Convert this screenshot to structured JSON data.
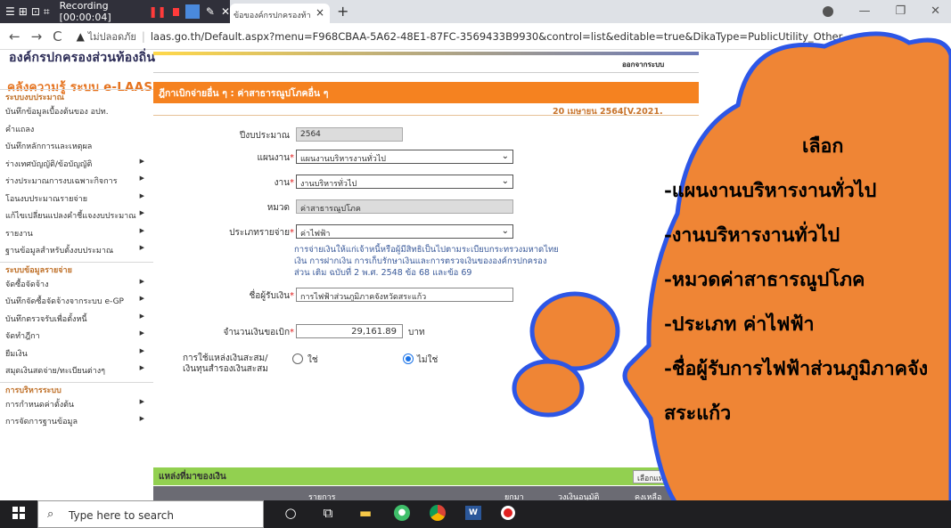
{
  "recorder": {
    "label": "Recording [00:00:04]"
  },
  "browser": {
    "tab_title": "ข้อของค์กรปกครองท้า",
    "not_secure": "ไม่ปลอดภัย",
    "url": "laas.go.th/Default.aspx?menu=F968CBAA-5A62-48E1-87FC-3569433B9930&control=list&editable=true&DikaType=PublicUtility_Other"
  },
  "header": {
    "org_name": "องค์กรปกครองส่วนท้องถิ่น",
    "logout": "ออกจากระบบ"
  },
  "sidebar": {
    "brand": "คลังความรู้ ระบบ e-LAAS",
    "sections": [
      {
        "title": "ระบบงบประมาณ",
        "items": [
          {
            "label": "บันทึกข้อมูลเบื้องต้นของ อปท.",
            "arrow": false
          },
          {
            "label": "คำแถลง",
            "arrow": false
          },
          {
            "label": "บันทึกหลักการและเหตุผล",
            "arrow": false
          },
          {
            "label": "ร่างเทศบัญญัติ/ข้อบัญญัติ",
            "arrow": true
          },
          {
            "label": "ร่างประมาณการงบเฉพาะกิจการ",
            "arrow": true
          },
          {
            "label": "โอนงบประมาณรายจ่าย",
            "arrow": true
          },
          {
            "label": "แก้ไขเปลี่ยนแปลงคำชี้แจงงบประมาณ",
            "arrow": true
          },
          {
            "label": "รายงาน",
            "arrow": true
          },
          {
            "label": "ฐานข้อมูลสำหรับตั้งงบประมาณ",
            "arrow": true
          }
        ]
      },
      {
        "title": "ระบบข้อมูลรายจ่าย",
        "items": [
          {
            "label": "จัดซื้อจัดจ้าง",
            "arrow": true
          },
          {
            "label": "บันทึกจัดซื้อจัดจ้างจากระบบ e-GP",
            "arrow": true
          },
          {
            "label": "บันทึกตรวจรับเพื่อตั้งหนี้",
            "arrow": true
          },
          {
            "label": "จัดทำฎีกา",
            "arrow": true
          },
          {
            "label": "ยืมเงิน",
            "arrow": true
          },
          {
            "label": "สมุดเงินสดจ่าย/ทะเบียนต่างๆ",
            "arrow": true
          }
        ]
      },
      {
        "title": "การบริหารระบบ",
        "items": [
          {
            "label": "การกำหนดค่าตั้งต้น",
            "arrow": true
          },
          {
            "label": "การจัดการฐานข้อมูล",
            "arrow": true
          }
        ]
      }
    ]
  },
  "page": {
    "title": "ฎีกาเบิกจ่ายอื่น ๆ : ค่าสาธารณูปโภคอื่น ๆ",
    "date_version": "20 เมษายน 2564[V.2021.",
    "fields": {
      "budget_year": {
        "label": "ปีงบประมาณ",
        "value": "2564"
      },
      "plan": {
        "label": "แผนงาน",
        "value": "แผนงานบริหารงานทั่วไป"
      },
      "work": {
        "label": "งาน",
        "value": "งานบริหารทั่วไป"
      },
      "category": {
        "label": "หมวด",
        "value": "ค่าสาธารณูปโภค"
      },
      "expense_type": {
        "label": "ประเภทรายจ่าย",
        "value": "ค่าไฟฟ้า"
      },
      "note": "การจ่ายเงินให้แก่เจ้าหนี้หรือผู้มีสิทธิเป็นไปตามระเบียบกระทรวงมหาดไทย เงิน การฝากเงิน การเก็บรักษาเงินและการตรวจเงินขององค์กรปกครองส่วน เติม ฉบับที่ 2 พ.ศ. 2548 ข้อ 68 และข้อ 69",
      "payee": {
        "label": "ชื่อผู้รับเงิน",
        "value": "การไฟฟ้าส่วนภูมิภาคจังหวัดสระแก้ว"
      },
      "amount": {
        "label": "จำนวนเงินขอเบิก",
        "value": "29,161.89",
        "unit": "บาท"
      },
      "reserve": {
        "label1": "การใช้แหล่งเงินสะสม/",
        "label2": "เงินทุนสำรองเงินสะสม",
        "yes": "ใช่",
        "no": "ไม่ใช่",
        "selected": "no"
      }
    },
    "source": {
      "title": "แหล่งที่มาของเงิน",
      "button": "เลือกแหล่งเงิน",
      "columns": [
        "รายการ",
        "ยกมา",
        "วงเงินอนุมัติ",
        "คงเหลือ"
      ]
    }
  },
  "callout": {
    "heading": "เลือก",
    "lines": [
      "-แผนงานบริหารงานทั่วไป",
      "-งานบริหารงานทั่วไป",
      "-หมวดค่าสาธารณูปโภค",
      "-ประเภท ค่าไฟฟ้า",
      "-ชื่อผู้รับการไฟฟ้าส่วนภูมิภาคจัง",
      "สระแก้ว"
    ],
    "fill": "#ef8535",
    "stroke": "#2d56e6"
  },
  "taskbar": {
    "search_placeholder": "Type here to search"
  }
}
